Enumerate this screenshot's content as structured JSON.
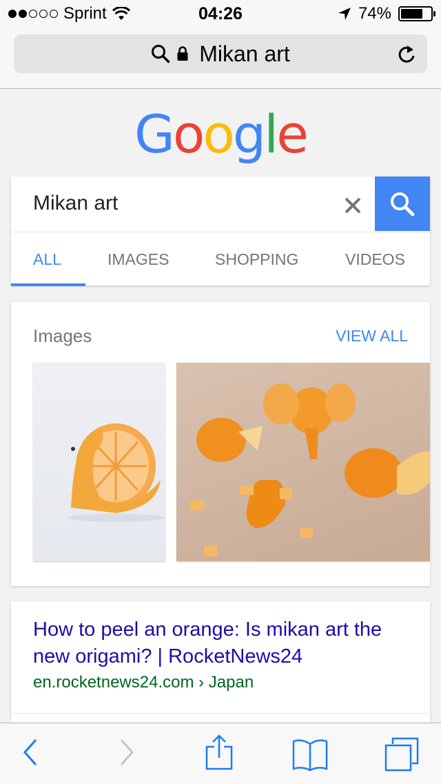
{
  "status_bar": {
    "carrier": "Sprint",
    "time": "04:26",
    "battery_text": "74%",
    "battery_level": 0.74,
    "signal_bars": 2
  },
  "url_bar": {
    "text": "Mikan art"
  },
  "logo": {
    "letters": [
      "G",
      "o",
      "o",
      "g",
      "l",
      "e"
    ],
    "colors": [
      "#4285f4",
      "#ea4335",
      "#fbbc05",
      "#4285f4",
      "#34a853",
      "#ea4335"
    ]
  },
  "search": {
    "query": "Mikan art"
  },
  "tabs": [
    {
      "label": "ALL",
      "active": true
    },
    {
      "label": "IMAGES",
      "active": false
    },
    {
      "label": "SHOPPING",
      "active": false
    },
    {
      "label": "VIDEOS",
      "active": false
    }
  ],
  "images_card": {
    "heading": "Images",
    "view_all": "VIEW ALL"
  },
  "result": {
    "title": "How to peel an orange: Is mikan art the new origami? | RocketNews24",
    "url": "en.rocketnews24.com › Japan"
  },
  "colors": {
    "accent": "#4285f4",
    "link": "#1a0dab",
    "url_green": "#006621",
    "ios_blue": "#1a7cf5"
  }
}
